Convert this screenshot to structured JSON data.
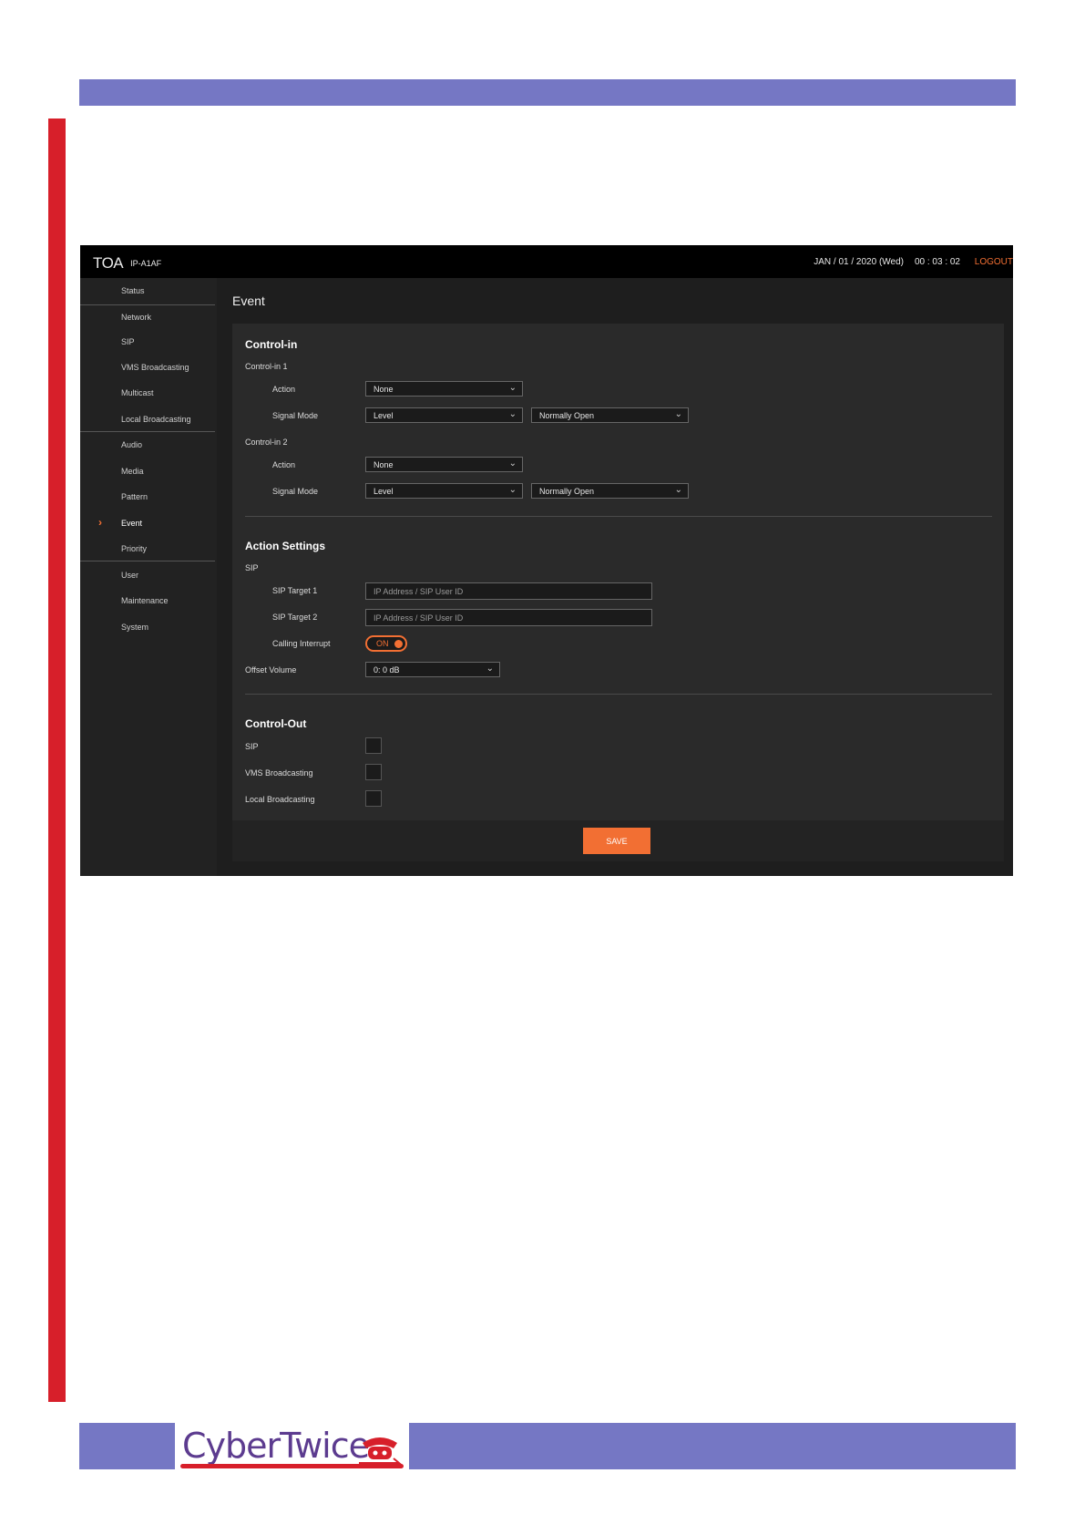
{
  "document": {
    "colors": {
      "band": "#7577c4",
      "accent_bar": "#d71f2a",
      "app_accent": "#f26f33"
    },
    "footer_logo": {
      "text": "CyberTwice",
      "icon": "phone-with-arrow-icon"
    }
  },
  "app": {
    "header": {
      "brand": "TOA",
      "model": "IP-A1AF",
      "date": "JAN / 01 / 2020 (Wed)",
      "time": "00 : 03 : 02",
      "logout": "LOGOUT"
    },
    "sidebar": {
      "items": [
        {
          "label": "Status"
        },
        {
          "label": "Network"
        },
        {
          "label": "SIP"
        },
        {
          "label": "VMS Broadcasting"
        },
        {
          "label": "Multicast"
        },
        {
          "label": "Local Broadcasting"
        },
        {
          "label": "Audio"
        },
        {
          "label": "Media"
        },
        {
          "label": "Pattern"
        },
        {
          "label": "Event",
          "active": true
        },
        {
          "label": "Priority"
        },
        {
          "label": "User"
        },
        {
          "label": "Maintenance"
        },
        {
          "label": "System"
        }
      ]
    },
    "page_title": "Event",
    "control_in": {
      "heading": "Control-in",
      "groups": [
        {
          "label": "Control-in 1",
          "action_label": "Action",
          "action_value": "None",
          "signal_mode_label": "Signal Mode",
          "signal_mode_value": "Level",
          "contact_value": "Normally Open"
        },
        {
          "label": "Control-in 2",
          "action_label": "Action",
          "action_value": "None",
          "signal_mode_label": "Signal Mode",
          "signal_mode_value": "Level",
          "contact_value": "Normally Open"
        }
      ]
    },
    "action_settings": {
      "heading": "Action Settings",
      "sip_label": "SIP",
      "sip_target_1_label": "SIP Target 1",
      "sip_target_1_placeholder": "IP Address / SIP User ID",
      "sip_target_2_label": "SIP Target 2",
      "sip_target_2_placeholder": "IP Address / SIP User ID",
      "calling_interrupt_label": "Calling Interrupt",
      "calling_interrupt_state": "ON",
      "offset_volume_label": "Offset Volume",
      "offset_volume_value": "0: 0 dB"
    },
    "control_out": {
      "heading": "Control-Out",
      "items": [
        {
          "label": "SIP",
          "checked": false
        },
        {
          "label": "VMS Broadcasting",
          "checked": false
        },
        {
          "label": "Local Broadcasting",
          "checked": false
        }
      ]
    },
    "save_label": "SAVE"
  }
}
